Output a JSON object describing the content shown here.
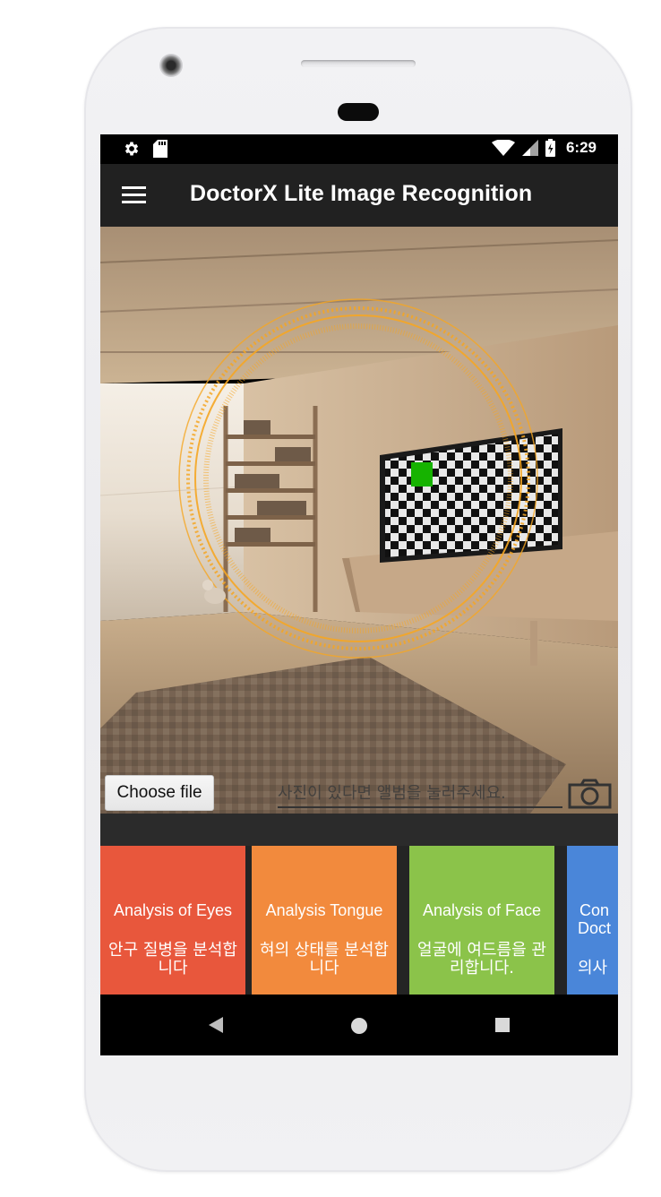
{
  "status_bar": {
    "left_icons": [
      "gear-icon",
      "sd-card-icon"
    ],
    "right_icons": [
      "wifi-icon",
      "signal-icon",
      "battery-charging-icon"
    ],
    "time": "6:29"
  },
  "app_bar": {
    "title": "DoctorX Lite Image Recognition",
    "menu_icon": "hamburger-menu-icon"
  },
  "viewer": {
    "image_desc_icon": "room-photo-with-scan-overlay",
    "scan_color": "#f5a623",
    "marker_color": "#16b300"
  },
  "controls": {
    "choose_file_label": "Choose file",
    "hint_placeholder": "사진이 있다면 앨범을 눌러주세요.",
    "camera_icon": "camera-icon"
  },
  "cards": [
    {
      "title": "Analysis of Eyes",
      "desc": "안구 질병을 분석합니다",
      "color": "#e8573c"
    },
    {
      "title": "Analysis Tongue",
      "desc": "혀의 상태를 분석합니다",
      "color": "#f28a3d"
    },
    {
      "title": "Analysis of Face",
      "desc": "얼굴에 여드름을 관리합니다.",
      "color": "#8bc34a"
    },
    {
      "title": "Con Doct",
      "desc": "의사",
      "color": "#4a86d9"
    }
  ],
  "nav_bar": {
    "back_icon": "back-triangle-icon",
    "home_icon": "home-circle-icon",
    "recents_icon": "recents-square-icon"
  }
}
